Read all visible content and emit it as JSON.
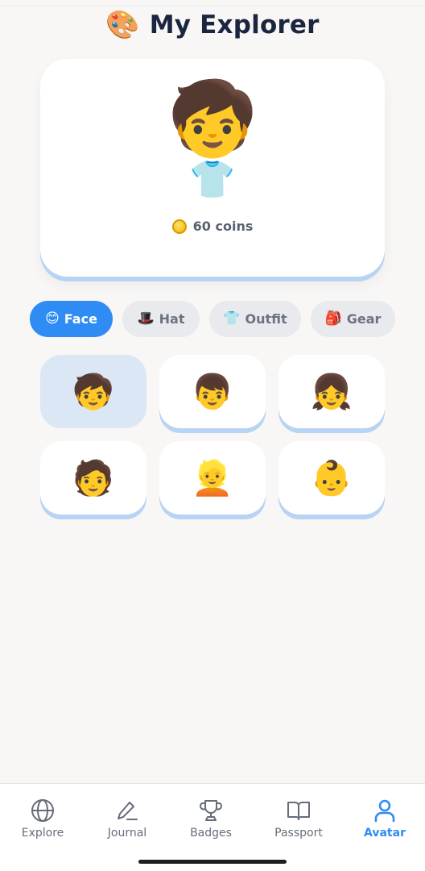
{
  "header": {
    "icon": "palette-icon",
    "icon_glyph": "🎨",
    "title": "My Explorer"
  },
  "preview": {
    "face_glyph": "🧒",
    "outfit_glyph": "👕",
    "coins_label": "60 coins",
    "coin_icon": "coin-icon"
  },
  "tabs": [
    {
      "id": "face",
      "glyph": "😊",
      "label": "Face",
      "active": true
    },
    {
      "id": "hat",
      "glyph": "🎩",
      "label": "Hat",
      "active": false
    },
    {
      "id": "outfit",
      "glyph": "👕",
      "label": "Outfit",
      "active": false
    },
    {
      "id": "gear",
      "glyph": "🎒",
      "label": "Gear",
      "active": false
    }
  ],
  "options": [
    {
      "glyph": "🧒",
      "selected": true
    },
    {
      "glyph": "👦",
      "selected": false
    },
    {
      "glyph": "👧",
      "selected": false
    },
    {
      "glyph": "🧑",
      "selected": false
    },
    {
      "glyph": "👱",
      "selected": false
    },
    {
      "glyph": "👶",
      "selected": false
    }
  ],
  "nav": [
    {
      "id": "explore",
      "label": "Explore",
      "icon": "globe-icon",
      "active": false
    },
    {
      "id": "journal",
      "label": "Journal",
      "icon": "pen-icon",
      "active": false
    },
    {
      "id": "badges",
      "label": "Badges",
      "icon": "trophy-icon",
      "active": false
    },
    {
      "id": "passport",
      "label": "Passport",
      "icon": "book-icon",
      "active": false
    },
    {
      "id": "avatar",
      "label": "Avatar",
      "icon": "user-icon",
      "active": true
    }
  ],
  "colors": {
    "accent": "#2f8cf4",
    "title": "#1c2540",
    "card_shadow": "#b8d4f4",
    "selected_bg": "#dbe7f5",
    "background": "#f8f7f5"
  }
}
